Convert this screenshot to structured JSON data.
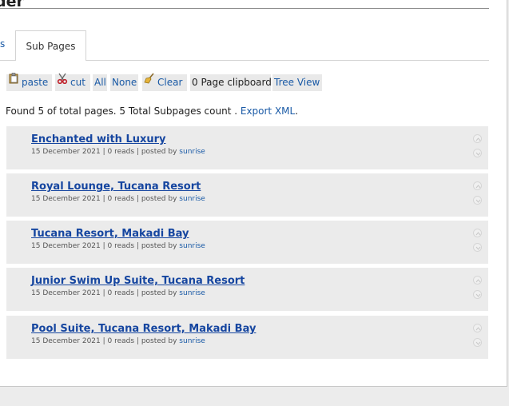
{
  "header": {
    "title": "der"
  },
  "tabs": {
    "left_partial": "s",
    "active": "Sub Pages"
  },
  "toolbar": {
    "paste": "paste",
    "cut": "cut",
    "all": "All",
    "none": "None",
    "clear": "Clear",
    "clipboard": "0 Page clipboard",
    "tree_view": "Tree View"
  },
  "summary": {
    "text": "Found 5 of total pages. 5 Total Subpages count . ",
    "export": "Export XML",
    "period": "."
  },
  "pages": [
    {
      "title": "Enchanted with Luxury",
      "date": "15 December 2021",
      "reads": "0 reads",
      "posted_by": "posted by",
      "author": "sunrise"
    },
    {
      "title": "Royal Lounge, Tucana Resort",
      "date": "15 December 2021",
      "reads": "0 reads",
      "posted_by": "posted by",
      "author": "sunrise"
    },
    {
      "title": "Tucana Resort, Makadi Bay",
      "date": "15 December 2021",
      "reads": "0 reads",
      "posted_by": "posted by",
      "author": "sunrise"
    },
    {
      "title": "Junior Swim Up Suite, Tucana Resort",
      "date": "15 December 2021",
      "reads": "0 reads",
      "posted_by": "posted by",
      "author": "sunrise"
    },
    {
      "title": "Pool Suite, Tucana Resort, Makadi Bay",
      "date": "15 December 2021",
      "reads": "0 reads",
      "posted_by": "posted by",
      "author": "sunrise"
    }
  ],
  "icons": {
    "paste": "clipboard-icon",
    "cut": "scissors-icon",
    "clear": "broom-icon",
    "move_up": "arrow-up-icon",
    "move_down": "arrow-down-icon"
  },
  "colors": {
    "link": "#1a5aa6",
    "title_link": "#1646a0",
    "row_bg": "#ebebeb"
  }
}
